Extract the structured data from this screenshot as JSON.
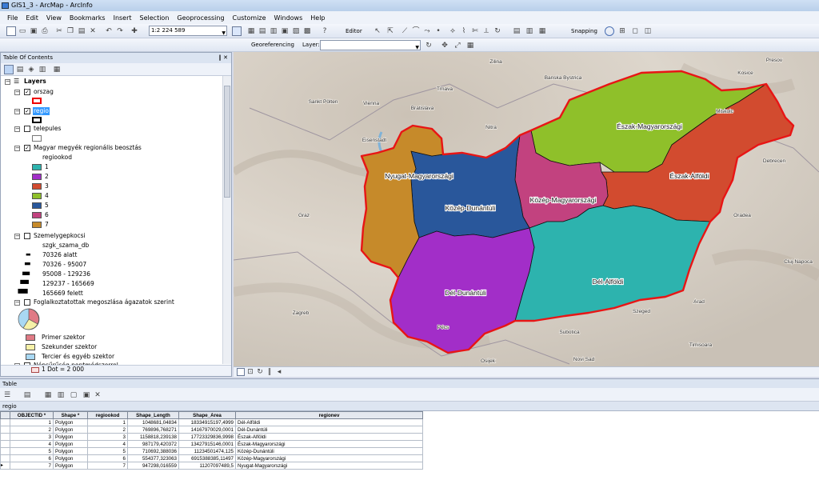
{
  "window": {
    "title": "GIS1_3 - ArcMap - ArcInfo"
  },
  "menu": [
    "File",
    "Edit",
    "View",
    "Bookmarks",
    "Insert",
    "Selection",
    "Geoprocessing",
    "Customize",
    "Windows",
    "Help"
  ],
  "toolbar": {
    "scale": "1:2 224 589",
    "editor_label": "Editor",
    "snapping_label": "Snapping",
    "georef_label": "Georeferencing",
    "layer_label": "Layer:"
  },
  "toc": {
    "title": "Table Of Contents",
    "title_controls": "‖ ✕",
    "layers_root": "Layers",
    "layers": {
      "orszag": "orszag",
      "regio": "regio",
      "telepules": "telepules",
      "megyek": "Magyar megyék regionális beosztás",
      "megyek_field": "regiookod",
      "classes": [
        "1",
        "2",
        "3",
        "4",
        "5",
        "6",
        "7"
      ],
      "class_colors": [
        "#2db3ae",
        "#a22ec8",
        "#d24b2f",
        "#8fc02a",
        "#29579b",
        "#c2427f",
        "#c68a2a"
      ],
      "szemely": "Szemelygepkocsi",
      "szemely_field": "szgk_szama_db",
      "szemely_classes": [
        "70326 alatt",
        "70326 - 95007",
        "95008 - 129236",
        "129237 - 165669",
        "165669 felett"
      ],
      "foglalk": "Foglalkoztatottak megoszlása ágazatok szerint",
      "sectors": [
        "Primer szektor",
        "Szekunder szektor",
        "Tercier és egyéb szektor"
      ],
      "sector_colors": [
        "#e07a85",
        "#f6f1a8",
        "#a9d8f3"
      ],
      "nepsur": "Népsűrűség pontmódszerrel",
      "nepsur_dot": "1 Dot = 2 000"
    }
  },
  "map": {
    "regions": [
      "Észak-Magyarországi",
      "Észak-Alföldi",
      "Közép-Magyarországi",
      "Nyugat-Magyarországi",
      "Közép-Dunántúli",
      "Dél-Dunántúli",
      "Dél-Alföldi"
    ],
    "cities": [
      "Vienna",
      "Bratislava",
      "Sankt Pölten",
      "Eisenstadt",
      "Graz",
      "Trnava",
      "Nitra",
      "Zilina",
      "Banska Bystrica",
      "Kosice",
      "Presov",
      "Miskolc",
      "Debrecen",
      "Oradea",
      "Cluj-Napoca",
      "Arad",
      "Timisoara",
      "Zagreb",
      "Osijek",
      "Novi Sad",
      "Subotica",
      "Szeged",
      "Pécs"
    ]
  },
  "table": {
    "title": "Table",
    "name": "regio",
    "columns": [
      "OBJECTID *",
      "Shape *",
      "regiookod",
      "Shape_Length",
      "Shape_Area",
      "regionev"
    ],
    "rows": [
      [
        "1",
        "Polygon",
        "1",
        "1048681,04834",
        "18334915197,4999",
        "Dél-Alföldi"
      ],
      [
        "2",
        "Polygon",
        "2",
        "769896,768271",
        "14167970029,0001",
        "Dél-Dunántúli"
      ],
      [
        "3",
        "Polygon",
        "3",
        "1158818,239138",
        "17723329836,9998",
        "Észak-Alföldi"
      ],
      [
        "4",
        "Polygon",
        "4",
        "987179,420372",
        "13427915146,0001",
        "Észak-Magyarországi"
      ],
      [
        "5",
        "Polygon",
        "5",
        "710692,388036",
        "11234501474,125",
        "Közép-Dunántúli"
      ],
      [
        "6",
        "Polygon",
        "6",
        "554377,323063",
        "6915388385,11497",
        "Közép-Magyarországi"
      ],
      [
        "7",
        "Polygon",
        "7",
        "947298,016559",
        "11207097489,5",
        "Nyugat-Magyarországi"
      ]
    ]
  }
}
